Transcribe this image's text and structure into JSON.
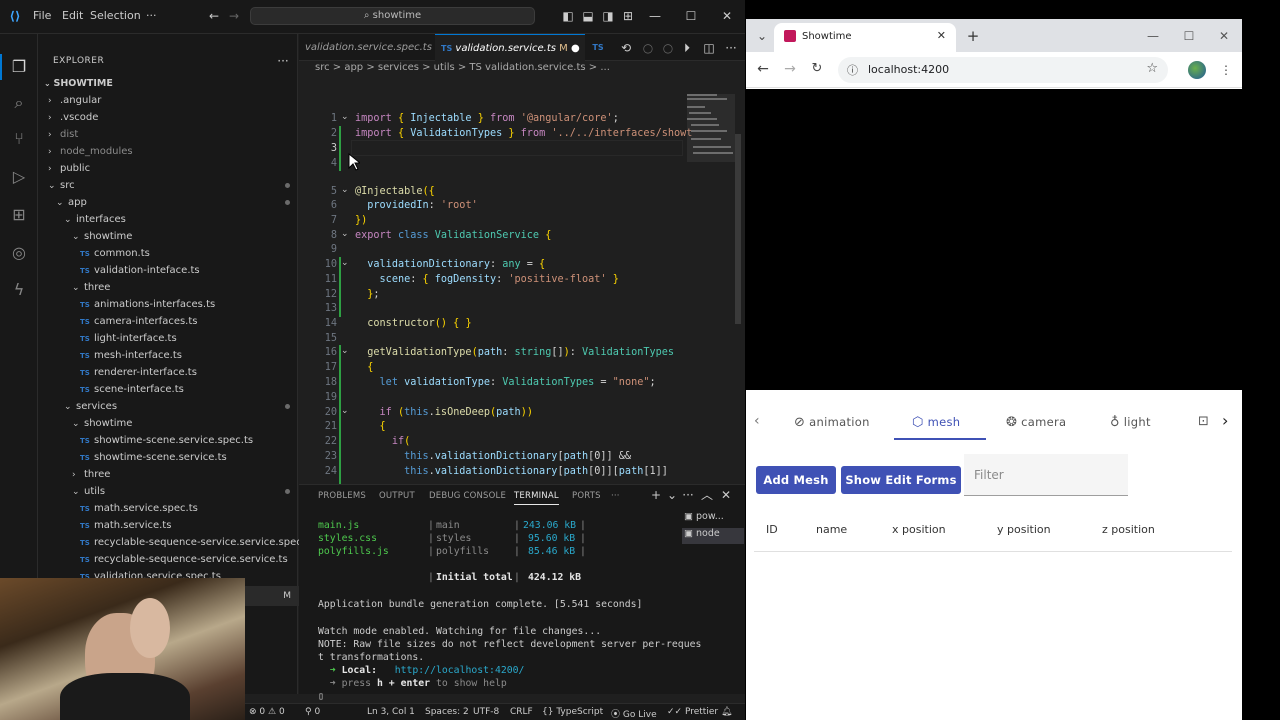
{
  "vscode": {
    "menu": [
      "File",
      "Edit",
      "Selection",
      "···"
    ],
    "search": "showtime",
    "explorer_title": "EXPLORER",
    "workspace": "SHOWTIME",
    "tree": [
      {
        "label": ".angular",
        "kind": "folder",
        "depth": 0,
        "open": false
      },
      {
        "label": ".vscode",
        "kind": "folder",
        "depth": 0,
        "open": false
      },
      {
        "label": "dist",
        "kind": "folder",
        "depth": 0,
        "open": false,
        "dim": true
      },
      {
        "label": "node_modules",
        "kind": "folder",
        "depth": 0,
        "open": false,
        "dim": true
      },
      {
        "label": "public",
        "kind": "folder",
        "depth": 0,
        "open": false
      },
      {
        "label": "src",
        "kind": "folder",
        "depth": 0,
        "open": true,
        "mod": true
      },
      {
        "label": "app",
        "kind": "folder",
        "depth": 1,
        "open": true,
        "mod": true
      },
      {
        "label": "interfaces",
        "kind": "folder",
        "depth": 2,
        "open": true
      },
      {
        "label": "showtime",
        "kind": "folder",
        "depth": 3,
        "open": true
      },
      {
        "label": "common.ts",
        "kind": "ts",
        "depth": 4
      },
      {
        "label": "validation-inteface.ts",
        "kind": "ts",
        "depth": 4
      },
      {
        "label": "three",
        "kind": "folder",
        "depth": 3,
        "open": true
      },
      {
        "label": "animations-interfaces.ts",
        "kind": "ts",
        "depth": 4
      },
      {
        "label": "camera-interfaces.ts",
        "kind": "ts",
        "depth": 4
      },
      {
        "label": "light-interface.ts",
        "kind": "ts",
        "depth": 4
      },
      {
        "label": "mesh-interface.ts",
        "kind": "ts",
        "depth": 4
      },
      {
        "label": "renderer-interface.ts",
        "kind": "ts",
        "depth": 4
      },
      {
        "label": "scene-interface.ts",
        "kind": "ts",
        "depth": 4
      },
      {
        "label": "services",
        "kind": "folder",
        "depth": 2,
        "open": true,
        "mod": true
      },
      {
        "label": "showtime",
        "kind": "folder",
        "depth": 3,
        "open": true
      },
      {
        "label": "showtime-scene.service.spec.ts",
        "kind": "ts",
        "depth": 4
      },
      {
        "label": "showtime-scene.service.ts",
        "kind": "ts",
        "depth": 4
      },
      {
        "label": "three",
        "kind": "folder",
        "depth": 3,
        "open": false
      },
      {
        "label": "utils",
        "kind": "folder",
        "depth": 3,
        "open": true,
        "mod": true
      },
      {
        "label": "math.service.spec.ts",
        "kind": "ts",
        "depth": 4
      },
      {
        "label": "math.service.ts",
        "kind": "ts",
        "depth": 4
      },
      {
        "label": "recyclable-sequence-service.service.spec.ts",
        "kind": "ts",
        "depth": 4
      },
      {
        "label": "recyclable-sequence-service.service.ts",
        "kind": "ts",
        "depth": 4
      },
      {
        "label": "validation.service.spec.ts",
        "kind": "ts",
        "depth": 4
      },
      {
        "label": "validation.service.ts",
        "kind": "ts",
        "depth": 4,
        "badge": "M"
      }
    ],
    "tabs": [
      {
        "label": "validation.service.spec.ts",
        "active": false
      },
      {
        "label": "validation.service.ts",
        "badge": "M",
        "active": true
      }
    ],
    "breadcrumb": "src > app > services > utils > TS validation.service.ts > ...",
    "code": [
      {
        "n": "1",
        "html": "<span class=\"kw\">import</span> <span class=\"p\">{</span> <span class=\"v\">Injectable</span> <span class=\"p\">}</span> <span class=\"kw\">from</span> <span class=\"s\">'@angular/core'</span>;"
      },
      {
        "n": "2",
        "html": "<span class=\"kw\">import</span> <span class=\"p\">{</span> <span class=\"v\">ValidationTypes</span> <span class=\"p\">}</span> <span class=\"kw\">from</span> <span class=\"s\">'../../interfaces/showt</span>"
      },
      {
        "n": "3",
        "html": ""
      },
      {
        "n": "4",
        "html": ""
      },
      {
        "n": "5",
        "html": "<span class=\"d\">@Injectable</span><span class=\"p\">({</span>"
      },
      {
        "n": "6",
        "html": "  <span class=\"v\">providedIn</span>: <span class=\"s\">'root'</span>"
      },
      {
        "n": "7",
        "html": "<span class=\"p\">})</span>"
      },
      {
        "n": "8",
        "html": "<span class=\"kw\">export</span> <span class=\"k\">class</span> <span class=\"t\">ValidationService</span> <span class=\"p\">{</span>"
      },
      {
        "n": "9",
        "html": ""
      },
      {
        "n": "10",
        "html": "  <span class=\"v\">validationDictionary</span>: <span class=\"t\">any</span> = <span class=\"p\">{</span>"
      },
      {
        "n": "11",
        "html": "    <span class=\"v\">scene</span>: <span class=\"p\">{</span> <span class=\"v\">fogDensity</span>: <span class=\"s\">'positive-float'</span> <span class=\"p\">}</span>"
      },
      {
        "n": "12",
        "html": "  <span class=\"p\">}</span>;"
      },
      {
        "n": "13",
        "html": ""
      },
      {
        "n": "14",
        "html": "  <span class=\"f\">constructor</span><span class=\"p\">()</span> <span class=\"p\">{ }</span>"
      },
      {
        "n": "15",
        "html": ""
      },
      {
        "n": "16",
        "html": "  <span class=\"f\">getValidationType</span><span class=\"p\">(</span><span class=\"v\">path</span>: <span class=\"t\">string</span>[]<span class=\"p\">)</span>: <span class=\"t\">ValidationTypes</span>"
      },
      {
        "n": "17",
        "html": "  <span class=\"p\">{</span>"
      },
      {
        "n": "18",
        "html": "    <span class=\"k\">let</span> <span class=\"v\">validationType</span>: <span class=\"t\">ValidationTypes</span> = <span class=\"s\">\"none\"</span>;"
      },
      {
        "n": "19",
        "html": ""
      },
      {
        "n": "20",
        "html": "    <span class=\"kw\">if</span> <span class=\"p\">(</span><span class=\"k\">this</span>.<span class=\"f\">isOneDeep</span><span class=\"p\">(</span><span class=\"v\">path</span><span class=\"p\">))</span>"
      },
      {
        "n": "21",
        "html": "    <span class=\"p\">{</span>"
      },
      {
        "n": "22",
        "html": "      <span class=\"kw\">if</span><span class=\"p\">(</span>"
      },
      {
        "n": "23",
        "html": "        <span class=\"k\">this</span>.<span class=\"v\">validationDictionary</span>[<span class=\"v\">path</span>[0]] &amp;&amp;"
      },
      {
        "n": "24",
        "html": "        <span class=\"k\">this</span>.<span class=\"v\">validationDictionary</span>[<span class=\"v\">path</span>[0]][<span class=\"v\">path</span>[1]]"
      }
    ],
    "panel_tabs": [
      "PROBLEMS",
      "OUTPUT",
      "DEBUG CONSOLE",
      "TERMINAL",
      "PORTS",
      "···"
    ],
    "terminal_list": [
      "pow...",
      "node"
    ],
    "terminal": {
      "rows": [
        {
          "file": "main.js",
          "name": "main",
          "size": "243.06 kB"
        },
        {
          "file": "styles.css",
          "name": "styles",
          "size": "95.60 kB"
        },
        {
          "file": "polyfills.js",
          "name": "polyfills",
          "size": "85.46 kB"
        }
      ],
      "total_label": "Initial total",
      "total_size": "424.12 kB",
      "bundle_msg": "Application bundle generation complete. [5.541 seconds]",
      "watch_msg": "Watch mode enabled. Watching for file changes...",
      "note1": "NOTE: Raw file sizes do not reflect development server per-reques",
      "note2": "t transformations.",
      "local_label": "Local:",
      "local_url": "http://localhost:4200/",
      "help_prefix": "press",
      "help_key": "h + enter",
      "help_suffix": "to show help"
    },
    "status": {
      "errors": "0",
      "warnings": "0",
      "ports": "0",
      "position": "Ln 3, Col 1",
      "spaces": "Spaces: 2",
      "encoding": "UTF-8",
      "eol": "CRLF",
      "language": "TypeScript",
      "golive": "Go Live",
      "prettier": "Prettier"
    }
  },
  "chrome": {
    "tab_title": "Showtime",
    "url": "localhost:4200",
    "app_tabs": [
      {
        "label": "animation",
        "icon": "animation-icon",
        "active": false
      },
      {
        "label": "mesh",
        "icon": "mesh-icon",
        "active": true
      },
      {
        "label": "camera",
        "icon": "camera-icon",
        "active": false
      },
      {
        "label": "light",
        "icon": "light-icon",
        "active": false
      }
    ],
    "add_mesh": "Add Mesh",
    "show_edit_forms": "Show Edit Forms",
    "filter_placeholder": "Filter",
    "columns": [
      "ID",
      "name",
      "x position",
      "y position",
      "z position"
    ]
  }
}
